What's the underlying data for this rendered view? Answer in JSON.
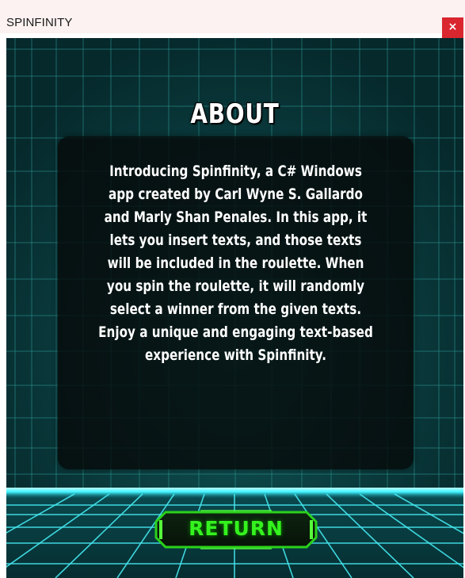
{
  "window": {
    "title": "SPINFINITY",
    "close_label": "×"
  },
  "about": {
    "heading": "ABOUT",
    "lines": [
      "Introducing Spinfinity, a C# Windows",
      "app created by Carl Wyne S. Gallardo",
      "and Marly Shan Penales. In this app, it",
      "lets you insert texts, and those texts",
      "will be included in the roulette. When",
      "you spin the roulette, it will randomly",
      "select a winner from the given texts.",
      "Enjoy a unique and engaging text-based",
      "experience with Spinfinity."
    ]
  },
  "actions": {
    "return_label": "RETURN"
  },
  "icons": {
    "close": "close-icon"
  },
  "colors": {
    "titlebar_bg": "#fbf2f1",
    "close_bg": "#d9262f",
    "background": "#0b3a3c",
    "grid_line": "#2fa8a3",
    "horizon_glow": "#42f4ff",
    "return_text": "#35f21f",
    "return_frame": "#2bd11b"
  }
}
